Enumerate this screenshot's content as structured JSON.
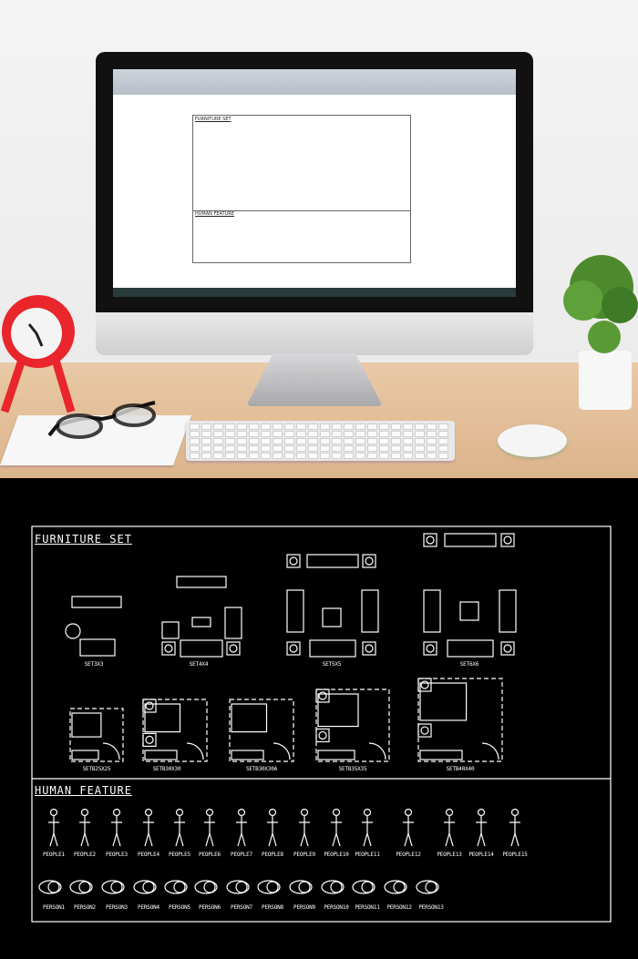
{
  "screen": {
    "furniture_title": "FURNITURE SET",
    "human_title": "HUMAN FEATURE"
  },
  "drawing": {
    "furniture_title": "FURNITURE SET",
    "human_title": "HUMAN FEATURE",
    "living_sets": [
      "SET3X3",
      "SET4X4",
      "SET5X5",
      "SET6X6"
    ],
    "bedroom_sets": [
      "SETB25X25",
      "SETB30X30",
      "SETB30X30A",
      "SETB35X35",
      "SETB40X40"
    ],
    "people": [
      "PEOPLE1",
      "PEOPLE2",
      "PEOPLE3",
      "PEOPLE4",
      "PEOPLE5",
      "PEOPLE6",
      "PEOPLE7",
      "PEOPLE8",
      "PEOPLE9",
      "PEOPLE10",
      "PEOPLE11",
      "PEOPLE12",
      "PEOPLE13",
      "PEOPLE14",
      "PEOPLE15"
    ],
    "persons": [
      "PERSON1",
      "PERSON2",
      "PERSON3",
      "PERSON4",
      "PERSON5",
      "PERSON6",
      "PERSON7",
      "PERSON8",
      "PERSON9",
      "PERSON10",
      "PERSON11",
      "PERSON12",
      "PERSON13"
    ]
  },
  "colors": {
    "cad_line": "#ffffff",
    "cad_background": "#000000",
    "clock": "#e8262b"
  }
}
